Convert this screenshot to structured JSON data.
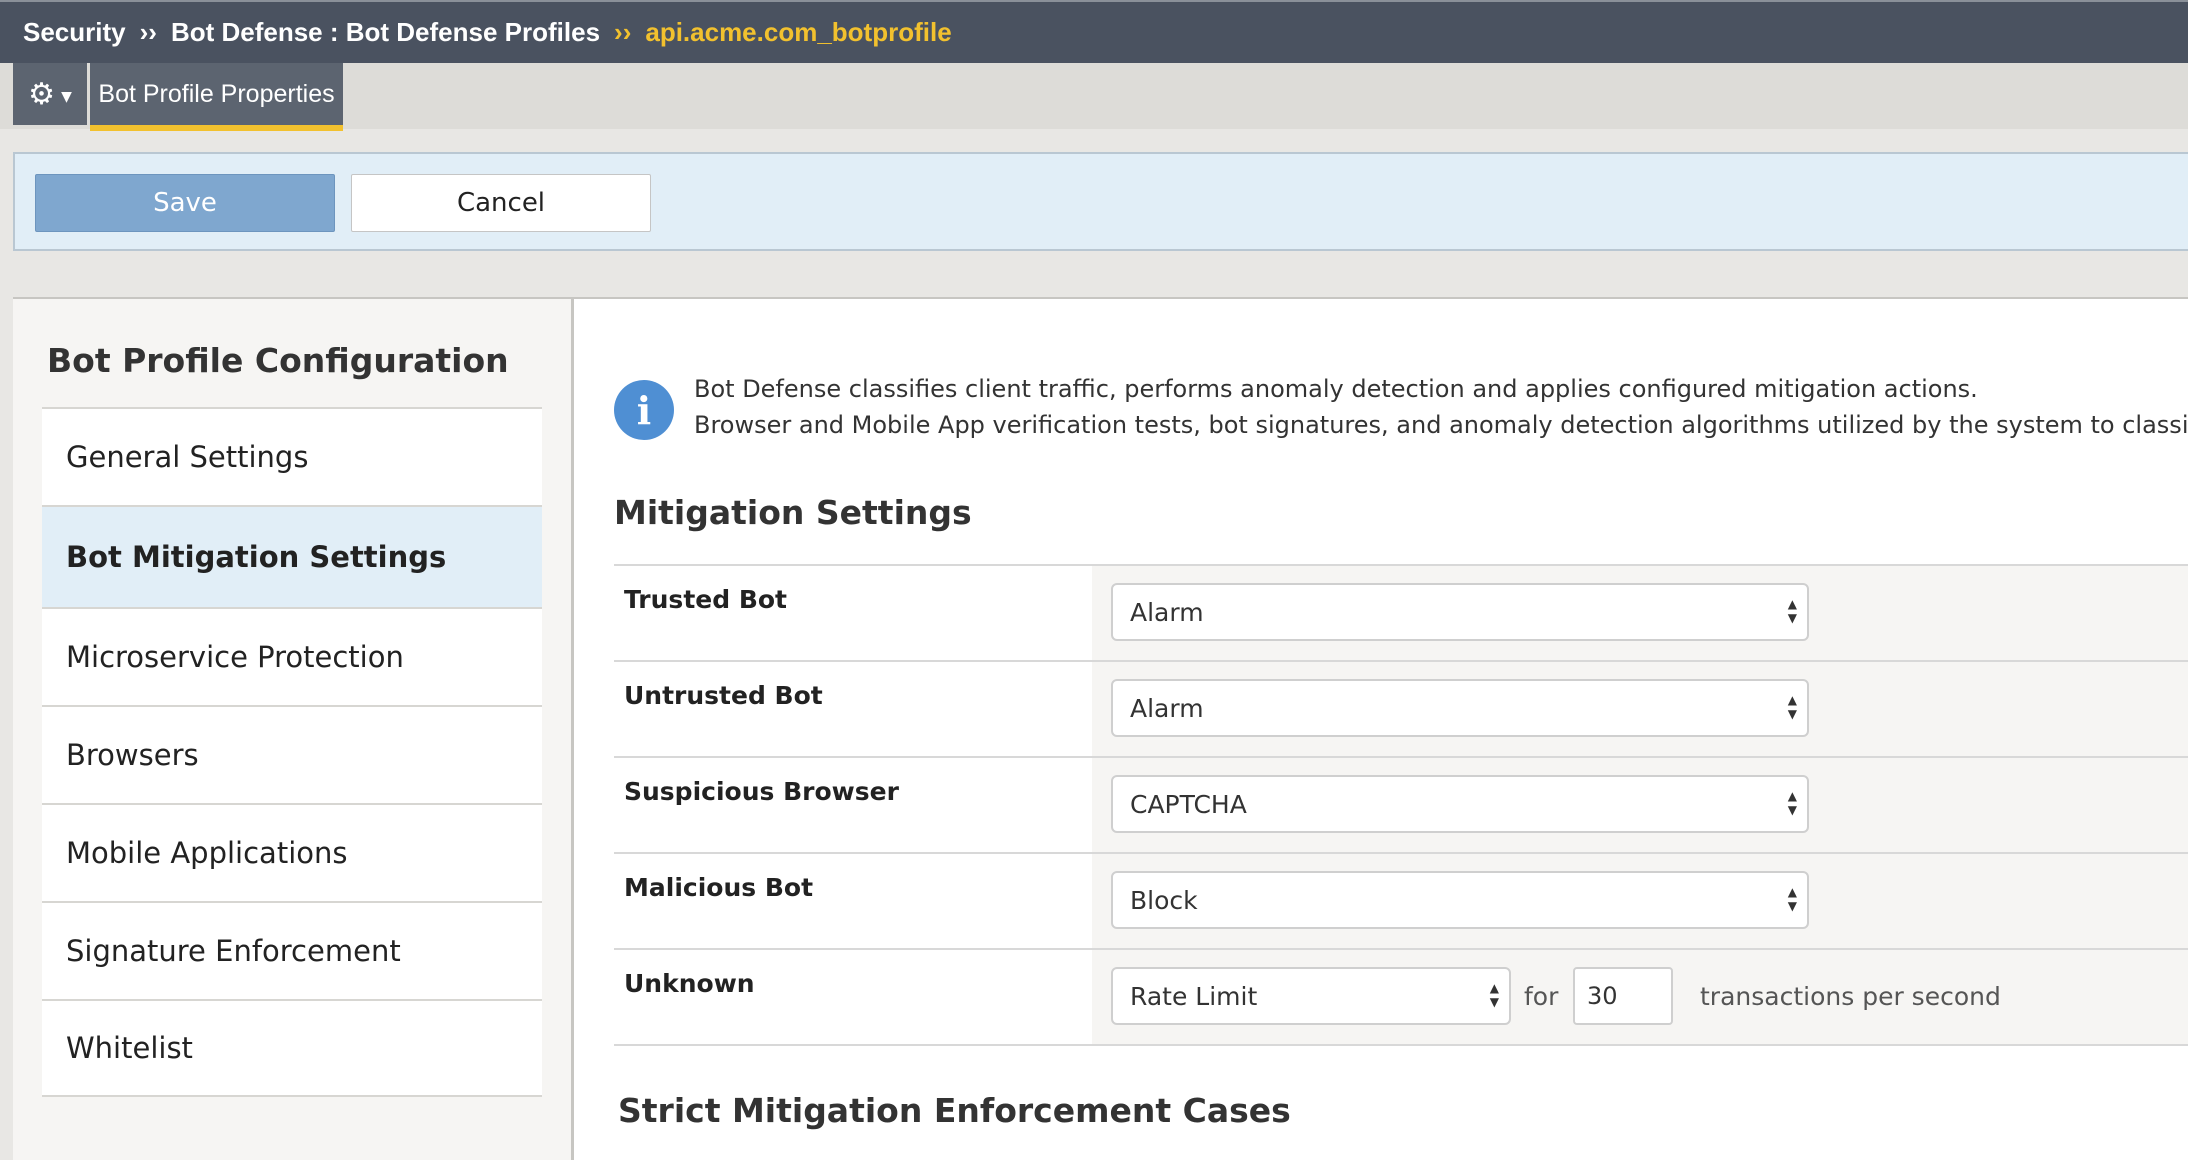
{
  "breadcrumb": {
    "section": "Security",
    "sep1": "››",
    "path": "Bot Defense : Bot Defense Profiles",
    "sep2": "››",
    "current": "api.acme.com_botprofile"
  },
  "tabs": {
    "gear_icon": "gear-icon",
    "active_tab": "Bot Profile Properties"
  },
  "actions": {
    "save_label": "Save",
    "cancel_label": "Cancel"
  },
  "sidebar": {
    "title": "Bot Profile Configuration",
    "items": [
      {
        "label": "General Settings"
      },
      {
        "label": "Bot Mitigation Settings"
      },
      {
        "label": "Microservice Protection"
      },
      {
        "label": "Browsers"
      },
      {
        "label": "Mobile Applications"
      },
      {
        "label": "Signature Enforcement"
      },
      {
        "label": "Whitelist"
      }
    ],
    "active_item": "Bot Mitigation Settings"
  },
  "info": {
    "icon": "info-icon",
    "line1": "Bot Defense classifies client traffic, performs anomaly detection and applies configured mitigation actions.",
    "line2": "Browser and Mobile App verification tests, bot signatures, and anomaly detection algorithms utilized by the system to classify clients"
  },
  "mitigation": {
    "title": "Mitigation Settings",
    "rows": [
      {
        "label": "Trusted Bot",
        "value": "Alarm"
      },
      {
        "label": "Untrusted Bot",
        "value": "Alarm"
      },
      {
        "label": "Suspicious Browser",
        "value": "CAPTCHA"
      },
      {
        "label": "Malicious Bot",
        "value": "Block"
      },
      {
        "label": "Unknown",
        "value": "Rate Limit",
        "for_text": "for",
        "rate": "30",
        "unit_text": "transactions per second"
      }
    ]
  },
  "strict": {
    "title": "Strict Mitigation Enforcement Cases"
  },
  "colors": {
    "header_bg": "#4a5260",
    "accent_gold": "#f2c12e",
    "save_blue": "#7fa7cf",
    "active_nav_bg": "#e1eef7",
    "info_blue": "#4f8fd3"
  }
}
